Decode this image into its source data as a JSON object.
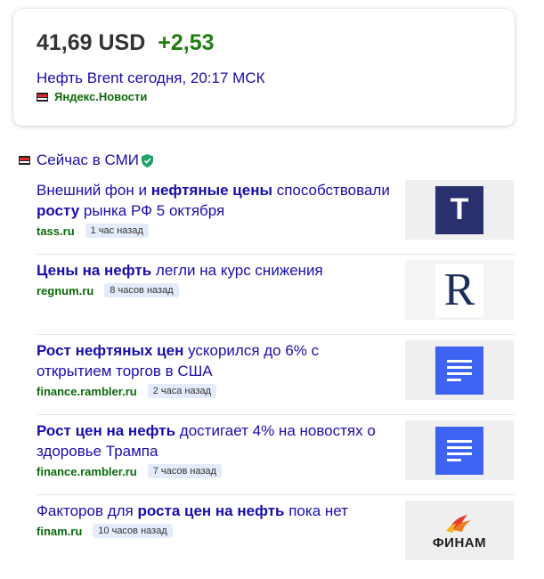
{
  "quote": {
    "price": "41,69 USD",
    "change": "+2,53",
    "subtitle": "Нефть Brent сегодня, 20:17 МСК",
    "source": "Яндекс.Новости"
  },
  "section": {
    "title": "Сейчас в СМИ"
  },
  "news": [
    {
      "title_parts": [
        {
          "text": "Внешний фон и ",
          "bold": false
        },
        {
          "text": "нефтяные цены",
          "bold": true
        },
        {
          "text": " способствовали ",
          "bold": false
        },
        {
          "text": "росту",
          "bold": true
        },
        {
          "text": " рынка РФ 5 октября",
          "bold": false
        }
      ],
      "source": "tass.ru",
      "time": "1 час назад",
      "thumb_icon": "tass-logo-icon",
      "thumb_letter": "Т"
    },
    {
      "title_parts": [
        {
          "text": "Цены на нефть",
          "bold": true
        },
        {
          "text": " легли на курс снижения",
          "bold": false
        }
      ],
      "source": "regnum.ru",
      "time": "8 часов назад",
      "thumb_icon": "regnum-logo-icon",
      "thumb_letter": "R"
    },
    {
      "title_parts": [
        {
          "text": "Рост нефтяных цен",
          "bold": true
        },
        {
          "text": " ускорился до 6% с открытием торгов в США",
          "bold": false
        }
      ],
      "source": "finance.rambler.ru",
      "time": "2 часа назад",
      "thumb_icon": "document-icon"
    },
    {
      "title_parts": [
        {
          "text": "Рост цен на нефть",
          "bold": true
        },
        {
          "text": " достигает 4% на новостях о здоровье Трампа",
          "bold": false
        }
      ],
      "source": "finance.rambler.ru",
      "time": "7 часов назад",
      "thumb_icon": "document-icon"
    },
    {
      "title_parts": [
        {
          "text": "Факторов для ",
          "bold": false
        },
        {
          "text": "роста цен на нефть",
          "bold": true
        },
        {
          "text": " пока нет",
          "bold": false
        }
      ],
      "source": "finam.ru",
      "time": "10 часов назад",
      "thumb_icon": "finam-logo-icon",
      "thumb_label": "ФИНАМ"
    }
  ],
  "colors": {
    "link": "#1a0dab",
    "source": "#0a6b0a",
    "positive": "#1e7e0e",
    "tass_bg": "#2a2f6e",
    "doc_blue": "#3d63f2"
  }
}
